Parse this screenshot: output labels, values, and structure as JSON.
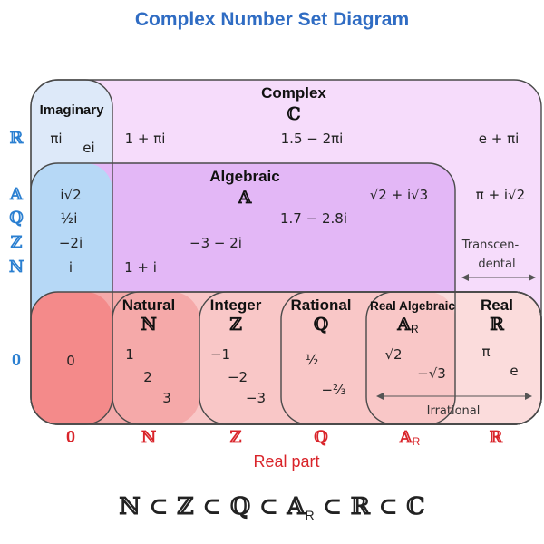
{
  "title": "Complex Number Set Diagram",
  "sets": {
    "imaginary": {
      "label": "Imaginary"
    },
    "complex": {
      "label": "Complex",
      "symbol": "ℂ"
    },
    "algebraic": {
      "label": "Algebraic",
      "symbol": "𝔸"
    },
    "natural": {
      "label": "Natural",
      "symbol": "ℕ"
    },
    "integer": {
      "label": "Integer",
      "symbol": "ℤ"
    },
    "rational": {
      "label": "Rational",
      "symbol": "ℚ"
    },
    "real_algebraic": {
      "label": "Real Algebraic",
      "symbol": "𝔸",
      "subscript": "R"
    },
    "real": {
      "label": "Real",
      "symbol": "ℝ"
    }
  },
  "imag_axis": {
    "ticks": [
      "ℝ",
      "𝔸",
      "ℚ",
      "ℤ",
      "ℕ",
      "0"
    ],
    "color": "#2a7fd1"
  },
  "real_axis": {
    "label": "Real part",
    "ticks": [
      {
        "text": "0"
      },
      {
        "text": "ℕ"
      },
      {
        "text": "ℤ"
      },
      {
        "text": "ℚ"
      },
      {
        "text": "𝔸",
        "sub": "R"
      },
      {
        "text": "ℝ"
      }
    ],
    "color": "#d9242a"
  },
  "numbers": {
    "pi_i": "πi",
    "e_i": "ei",
    "one_plus_pi_i": "1 + πi",
    "c1": "1.5 − 2πi",
    "c2": "e + πi",
    "i_sqrt2": "i√2",
    "half_i": "½",
    "half_i_suffix": "i",
    "minus_2i": "−2i",
    "i": "i",
    "a1": "√2 + i√3",
    "a2": "1.7 − 2.8i",
    "a3": "−3 − 2i",
    "a4": "1 + i",
    "c3": "π + i√2",
    "zero": "0",
    "n1": "1",
    "n2": "2",
    "n3": "3",
    "z1": "−1",
    "z2": "−2",
    "z3": "−3",
    "q1": "½",
    "q2": "−⅔",
    "ra1": "√2",
    "ra2": "−√3",
    "r1": "π",
    "r2": "e"
  },
  "annotations": {
    "transcendental_1": "Transcen-",
    "transcendental_2": "dental",
    "irrational": "Irrational"
  },
  "subset_chain": {
    "parts": [
      "ℕ",
      " ⊂ ",
      "ℤ",
      " ⊂ ",
      "ℚ",
      " ⊂ ",
      "𝔸",
      "R",
      " ⊂ ",
      "ℝ",
      " ⊂ ",
      "ℂ"
    ]
  },
  "colors": {
    "complex_fill": "#f6dcfb",
    "imaginary_fill": "#dde9f9",
    "algebraic_fill": "#e3b7f6",
    "imag_alg_fill": "#b6d8f6",
    "real_fill": "#fbdcdc",
    "real_alg_fill": "#f9c7c7",
    "natural_fill": "#f5a9a9",
    "zero_fill": "#f48a8a",
    "axis_blue": "#2a7fd1",
    "axis_red": "#d9242a",
    "title_blue": "#2f6cc3"
  }
}
